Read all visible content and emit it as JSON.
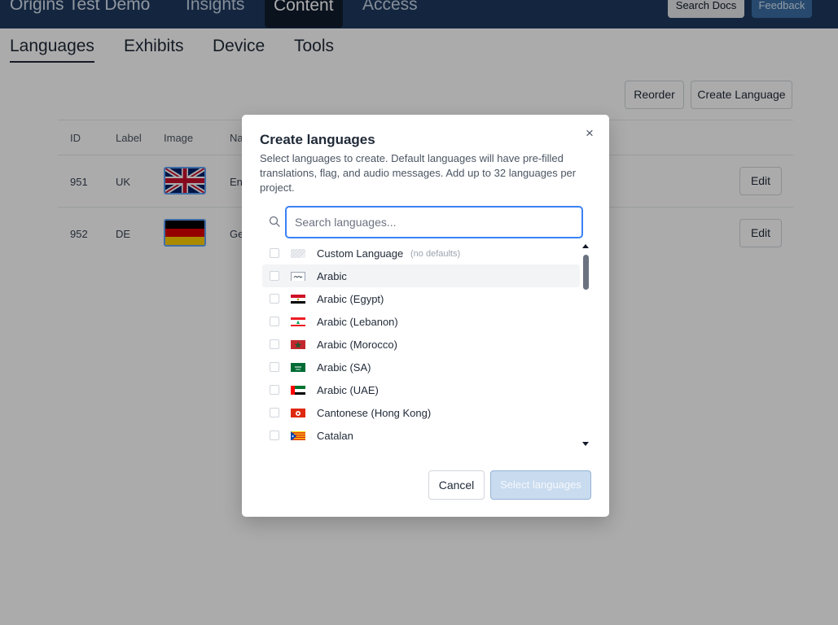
{
  "app": {
    "title": "Origins Test Demo",
    "nav": [
      {
        "label": "Insights"
      },
      {
        "label": "Content",
        "active": true
      },
      {
        "label": "Access"
      }
    ],
    "search_docs_label": "Search Docs",
    "feedback_label": "Feedback"
  },
  "subnav": [
    {
      "label": "Languages",
      "active": true
    },
    {
      "label": "Exhibits"
    },
    {
      "label": "Device"
    },
    {
      "label": "Tools"
    }
  ],
  "toolbar": {
    "reorder_label": "Reorder",
    "create_label": "Create Language"
  },
  "table": {
    "headers": {
      "id": "ID",
      "label": "Label",
      "image": "Image",
      "name": "Na"
    },
    "rows": [
      {
        "id": "951",
        "label": "UK",
        "name": "En",
        "flag": "uk",
        "edit": "Edit"
      },
      {
        "id": "952",
        "label": "DE",
        "name": "Ge",
        "flag": "de",
        "edit": "Edit"
      }
    ]
  },
  "modal": {
    "title": "Create languages",
    "close_glyph": "×",
    "description": "Select languages to create. Default languages will have pre-filled translations, flag, and audio messages. Add up to 32 languages per project.",
    "search_placeholder": "Search languages...",
    "items": [
      {
        "name": "Custom Language",
        "note": "(no defaults)",
        "flag": "custom"
      },
      {
        "name": "Arabic",
        "flag": "arabic",
        "hover": true
      },
      {
        "name": "Arabic (Egypt)",
        "flag": "egypt"
      },
      {
        "name": "Arabic (Lebanon)",
        "flag": "lebanon"
      },
      {
        "name": "Arabic (Morocco)",
        "flag": "morocco"
      },
      {
        "name": "Arabic (SA)",
        "flag": "saudi"
      },
      {
        "name": "Arabic (UAE)",
        "flag": "uae"
      },
      {
        "name": "Cantonese (Hong Kong)",
        "flag": "hongkong"
      },
      {
        "name": "Catalan",
        "flag": "catalan"
      }
    ],
    "cancel_label": "Cancel",
    "submit_label": "Select languages"
  },
  "colors": {
    "topbar": "#1e3a5f",
    "accent": "#3b82f6",
    "submit_disabled": "#c9dbef"
  }
}
